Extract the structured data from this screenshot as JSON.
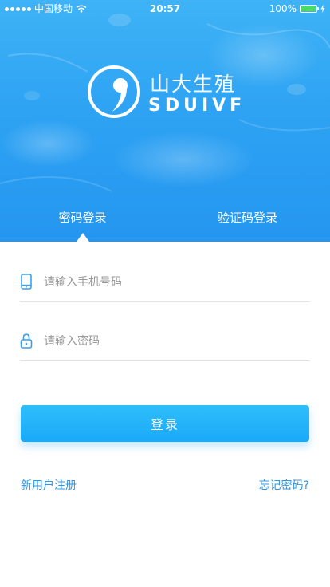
{
  "status_bar": {
    "carrier": "中国移动",
    "time": "20:57",
    "battery": "100%",
    "battery_level": 1.0,
    "icons": [
      "signal-dots-icon",
      "wifi-icon",
      "battery-icon",
      "charging-bolt-icon"
    ]
  },
  "brand": {
    "name_cn": "山大生殖",
    "name_en": "SDUIVF",
    "icon": "logo-mark-icon"
  },
  "tabs": [
    {
      "label": "密码登录",
      "active": true
    },
    {
      "label": "验证码登录",
      "active": false
    }
  ],
  "form": {
    "phone": {
      "placeholder": "请输入手机号码",
      "value": "",
      "icon": "phone-icon"
    },
    "password": {
      "placeholder": "请输入密码",
      "value": "",
      "icon": "lock-icon"
    },
    "submit_label": "登录"
  },
  "links": {
    "register": "新用户注册",
    "forgot": "忘记密码?"
  },
  "colors": {
    "header_top": "#3fb3f6",
    "header_bottom": "#2496f0",
    "button": "#1aa9f7",
    "link": "#2b97e8",
    "icon": "#3aa0ec",
    "battery_fill": "#4cd964"
  }
}
